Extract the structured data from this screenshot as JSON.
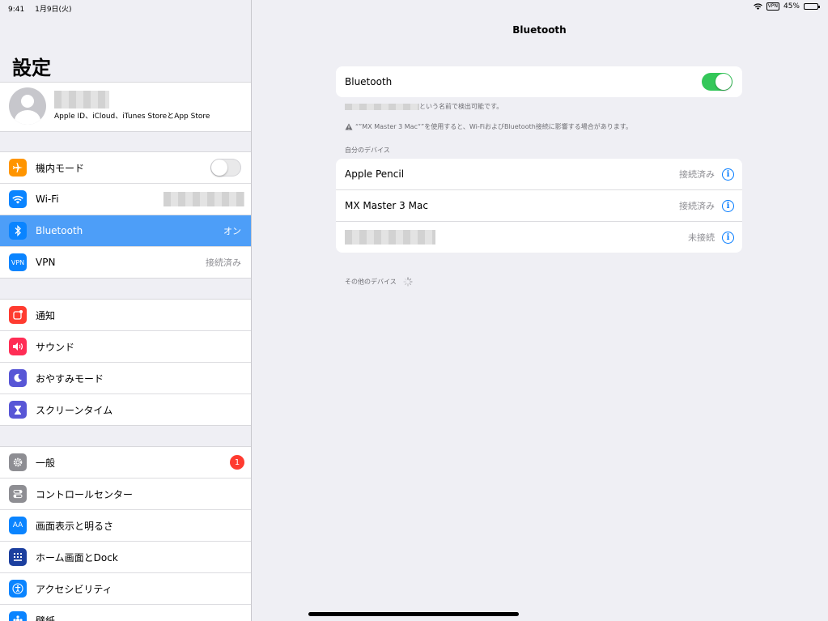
{
  "status_bar": {
    "time": "9:41",
    "date": "1月9日(火)",
    "vpn": "VPN",
    "battery": "45%",
    "battery_level": 0.45
  },
  "sidebar": {
    "title": "設定",
    "profile_subtitle": "Apple ID、iCloud、iTunes StoreとApp Store",
    "group1": [
      {
        "label": "機内モード",
        "icon": "airplane-icon",
        "toggle": false
      },
      {
        "label": "Wi-Fi",
        "icon": "wifi-icon"
      },
      {
        "label": "Bluetooth",
        "icon": "bluetooth-icon",
        "value": "オン",
        "selected": true
      },
      {
        "label": "VPN",
        "icon": "vpn-icon",
        "icon_text": "VPN",
        "value": "接続済み"
      }
    ],
    "group2": [
      {
        "label": "通知",
        "icon": "notifications-icon"
      },
      {
        "label": "サウンド",
        "icon": "sound-icon"
      },
      {
        "label": "おやすみモード",
        "icon": "moon-icon"
      },
      {
        "label": "スクリーンタイム",
        "icon": "hourglass-icon"
      }
    ],
    "group3": [
      {
        "label": "一般",
        "icon": "gear-icon",
        "badge": "1"
      },
      {
        "label": "コントロールセンター",
        "icon": "control-center-icon"
      },
      {
        "label": "画面表示と明るさ",
        "icon": "display-icon",
        "icon_text": "AA"
      },
      {
        "label": "ホーム画面とDock",
        "icon": "home-screen-icon"
      },
      {
        "label": "アクセシビリティ",
        "icon": "accessibility-icon"
      },
      {
        "label": "壁紙",
        "icon": "wallpaper-icon"
      }
    ]
  },
  "main": {
    "title": "Bluetooth",
    "bluetooth_label": "Bluetooth",
    "bluetooth_on": true,
    "discoverable_note": "という名前で検出可能です。",
    "warning_note": "“”MX Master 3 Mac“”を使用すると、Wi-FiおよびBluetooth接続に影響する場合があります。",
    "my_devices_header": "自分のデバイス",
    "devices": [
      {
        "name": "Apple Pencil",
        "status": "接続済み"
      },
      {
        "name": "MX Master 3 Mac",
        "status": "接続済み"
      },
      {
        "name": "",
        "status": "未接続"
      }
    ],
    "other_devices_header": "その他のデバイス"
  },
  "colors": {
    "accent": "#007aff",
    "selected_row": "#4d9ef8",
    "toggle_on": "#34c759",
    "badge": "#ff3b30"
  }
}
